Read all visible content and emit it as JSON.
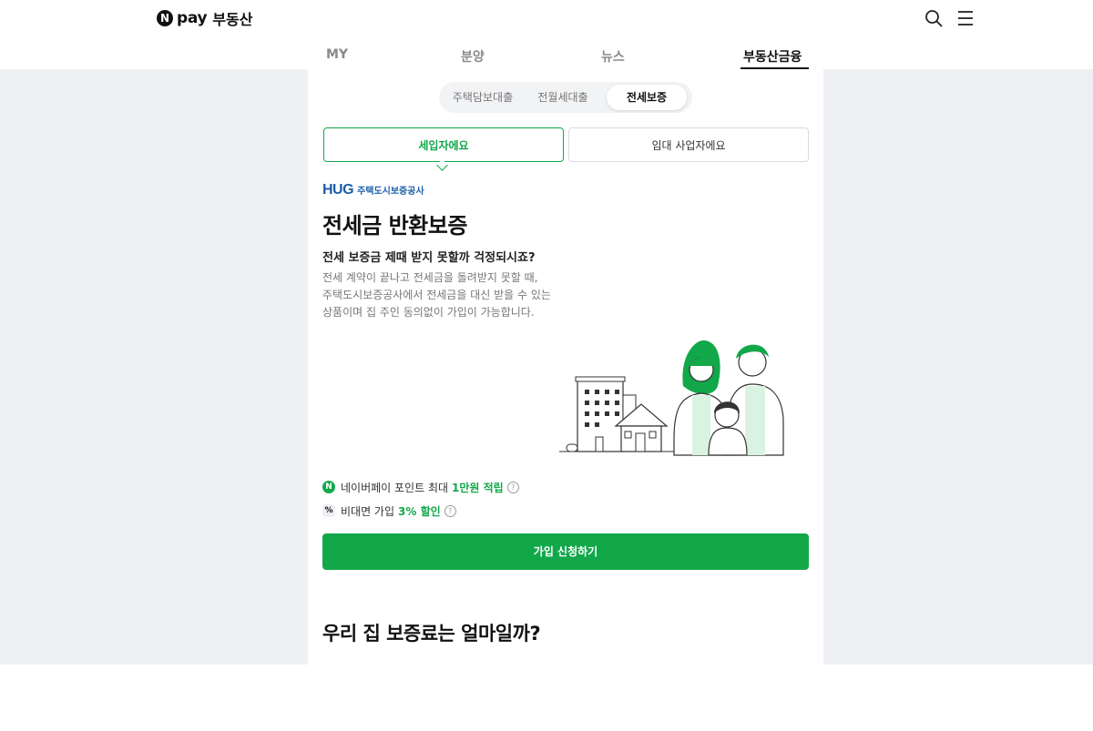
{
  "brand": {
    "n_mark": "N",
    "pay": "pay",
    "name": "부동산"
  },
  "header_icons": {
    "search": "search-icon",
    "menu": "menu-icon"
  },
  "nav": {
    "tabs": [
      {
        "label": "MY"
      },
      {
        "label": "분양"
      },
      {
        "label": "뉴스"
      },
      {
        "label": "부동산금융",
        "active": true
      }
    ]
  },
  "segment": {
    "items": [
      {
        "label": "주택담보대출"
      },
      {
        "label": "전월세대출"
      },
      {
        "label": "전세보증",
        "active": true
      }
    ]
  },
  "role": {
    "tenant": "세입자에요",
    "landlord": "임대 사업자에요",
    "selected": "세입자에요"
  },
  "product": {
    "issuer_logo": "HUG",
    "issuer_name": "주택도시보증공사",
    "title": "전세금 반환보증",
    "subtitle": "전세 보증금 제때 받지 못할까 걱정되시죠?",
    "description": [
      "전세 계약이 끝나고 전세금을 돌려받지 못할 때,",
      "주택도시보증공사에서 전세금을 대신 받을 수 있는",
      "상품이며 집 주인 동의없이 가입이 가능합니다."
    ]
  },
  "benefits": [
    {
      "icon": "N",
      "text": "네이버페이 포인트 최대",
      "highlight": "1만원 적립",
      "help": "?"
    },
    {
      "icon": "%",
      "text": "비대면 가입",
      "highlight": "3% 할인",
      "help": "?"
    }
  ],
  "cta": {
    "label": "가입 신청하기"
  },
  "next_section": {
    "title": "우리 집 보증료는 얼마일까?"
  },
  "colors": {
    "accent": "#12a84a",
    "hug_blue": "#1b5ea8",
    "page_bg": "#eef0f3"
  }
}
